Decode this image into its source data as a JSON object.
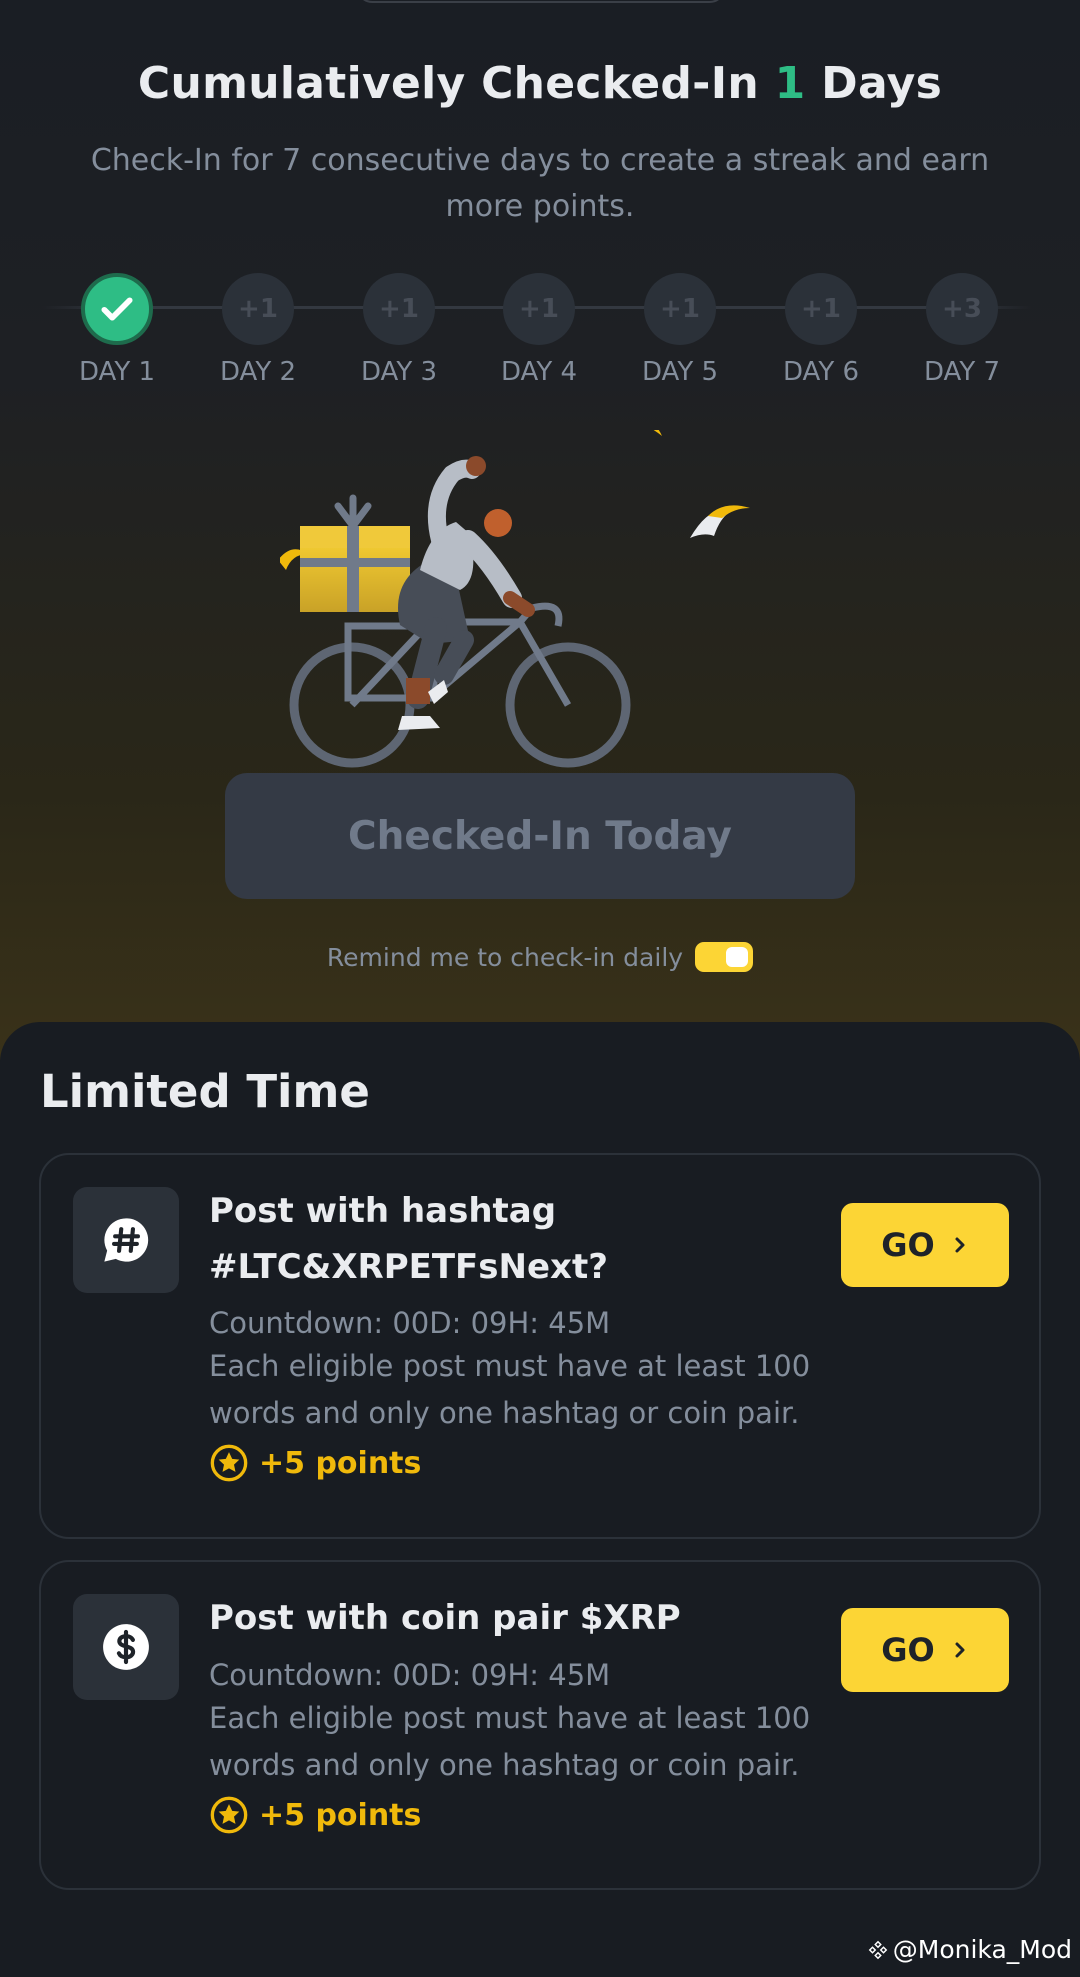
{
  "header": {
    "title_prefix": "Cumulatively Checked-In ",
    "title_count": "1",
    "title_suffix": " Days",
    "subtitle": "Check-In for 7 consecutive days to create a streak and earn more points."
  },
  "streak": {
    "days": [
      {
        "label": "DAY 1",
        "reward": "",
        "done": true
      },
      {
        "label": "DAY 2",
        "reward": "+1",
        "done": false
      },
      {
        "label": "DAY 3",
        "reward": "+1",
        "done": false
      },
      {
        "label": "DAY 4",
        "reward": "+1",
        "done": false
      },
      {
        "label": "DAY 5",
        "reward": "+1",
        "done": false
      },
      {
        "label": "DAY 6",
        "reward": "+1",
        "done": false
      },
      {
        "label": "DAY 7",
        "reward": "+3",
        "done": false
      }
    ]
  },
  "checkin": {
    "button_label": "Checked-In Today",
    "remind_label": "Remind me to check-in daily",
    "remind_enabled": true
  },
  "limited": {
    "section_title": "Limited Time",
    "tasks": [
      {
        "icon": "hashtag-chat-icon",
        "title": "Post with hashtag #LTC&XRPETFsNext?",
        "countdown": "Countdown: 00D: 09H: 45M",
        "description": "Each eligible post must have at least 100 words and only one hashtag or coin pair.",
        "points": "+5 points",
        "button": "GO"
      },
      {
        "icon": "dollar-coin-icon",
        "title": "Post with coin pair $XRP",
        "countdown": "Countdown: 00D: 09H: 45M",
        "description": "Each eligible post must have at least 100 words and only one hashtag or coin pair.",
        "points": "+5 points",
        "button": "GO"
      }
    ]
  },
  "watermark": "@Monika_Mod",
  "colors": {
    "accent": "#fcd535",
    "success": "#2ebd85",
    "points": "#f0b90b",
    "background": "#181c22"
  }
}
